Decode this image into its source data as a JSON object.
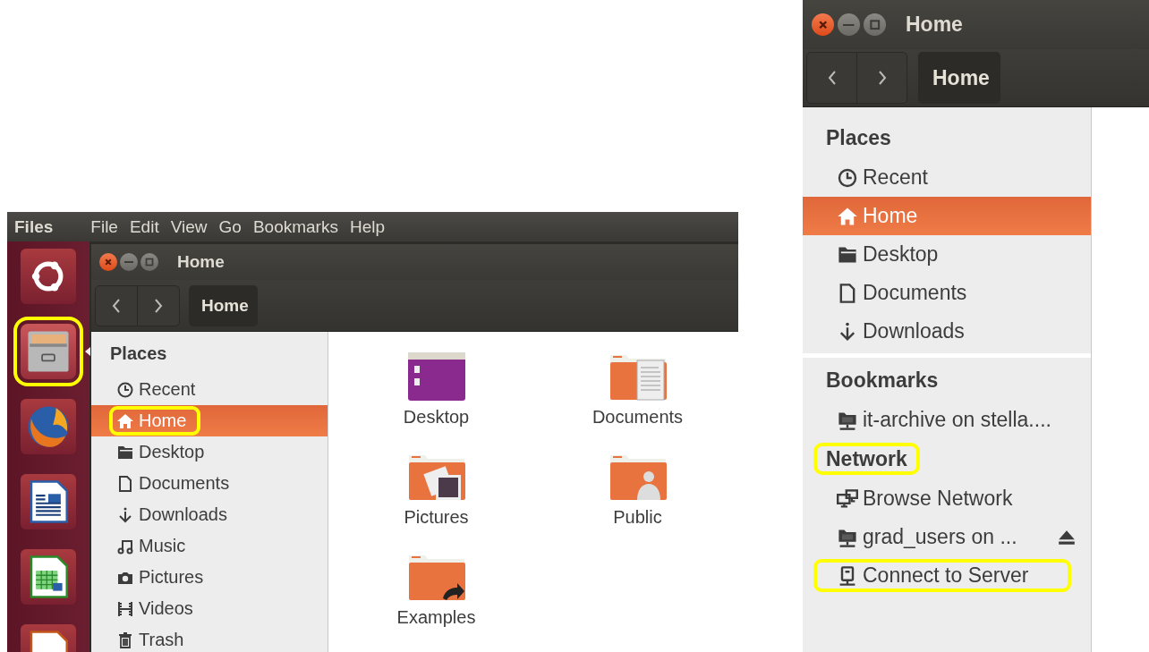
{
  "left_screenshot": {
    "top_panel": {
      "app_name": "Files",
      "menu": [
        "File",
        "Edit",
        "View",
        "Go",
        "Bookmarks",
        "Help"
      ]
    },
    "launcher": [
      {
        "kind": "dash",
        "active": false,
        "highlighted": false
      },
      {
        "kind": "files",
        "active": true,
        "highlighted": true
      },
      {
        "kind": "browser",
        "active": false,
        "highlighted": false
      },
      {
        "kind": "writer",
        "active": false,
        "highlighted": false
      },
      {
        "kind": "spreadsheet",
        "active": false,
        "highlighted": false
      },
      {
        "kind": "presentation",
        "active": false,
        "highlighted": false
      }
    ],
    "window": {
      "title": "Home",
      "path_button": "Home"
    },
    "sidebar": {
      "heading": "Places",
      "items": [
        {
          "label": "Recent",
          "kind": "clock",
          "selected": false,
          "highlighted": false
        },
        {
          "label": "Home",
          "kind": "home",
          "selected": true,
          "highlighted": true
        },
        {
          "label": "Desktop",
          "kind": "folder",
          "selected": false,
          "highlighted": false
        },
        {
          "label": "Documents",
          "kind": "document",
          "selected": false,
          "highlighted": false
        },
        {
          "label": "Downloads",
          "kind": "download",
          "selected": false,
          "highlighted": false
        },
        {
          "label": "Music",
          "kind": "music",
          "selected": false,
          "highlighted": false
        },
        {
          "label": "Pictures",
          "kind": "camera",
          "selected": false,
          "highlighted": false
        },
        {
          "label": "Videos",
          "kind": "film",
          "selected": false,
          "highlighted": false
        },
        {
          "label": "Trash",
          "kind": "trash",
          "selected": false,
          "highlighted": false
        }
      ]
    },
    "files": [
      {
        "name": "Desktop",
        "kind": "desktop"
      },
      {
        "name": "Documents",
        "kind": "documents"
      },
      {
        "name": "Pictures",
        "kind": "pictures"
      },
      {
        "name": "Public",
        "kind": "public"
      },
      {
        "name": "Examples",
        "kind": "link"
      }
    ]
  },
  "right_screenshot": {
    "window": {
      "title": "Home",
      "path_button": "Home"
    },
    "sections": [
      {
        "heading": "Places",
        "highlighted": false,
        "items": [
          {
            "label": "Recent",
            "kind": "clock",
            "selected": false,
            "highlighted": false,
            "ejectable": false
          },
          {
            "label": "Home",
            "kind": "home",
            "selected": true,
            "highlighted": false,
            "ejectable": false
          },
          {
            "label": "Desktop",
            "kind": "folder",
            "selected": false,
            "highlighted": false,
            "ejectable": false
          },
          {
            "label": "Documents",
            "kind": "document",
            "selected": false,
            "highlighted": false,
            "ejectable": false
          },
          {
            "label": "Downloads",
            "kind": "download",
            "selected": false,
            "highlighted": false,
            "ejectable": false
          }
        ]
      },
      {
        "heading": "Bookmarks",
        "highlighted": false,
        "items": [
          {
            "label": "it-archive on stella....",
            "kind": "network-folder",
            "selected": false,
            "highlighted": false,
            "ejectable": false
          }
        ]
      },
      {
        "heading": "Network",
        "highlighted": true,
        "items": [
          {
            "label": "Browse Network",
            "kind": "computers",
            "selected": false,
            "highlighted": false,
            "ejectable": false
          },
          {
            "label": "grad_users on ...",
            "kind": "network-folder",
            "selected": false,
            "highlighted": false,
            "ejectable": true
          },
          {
            "label": "Connect to Server",
            "kind": "server",
            "selected": false,
            "highlighted": true,
            "ejectable": false
          }
        ]
      }
    ]
  }
}
